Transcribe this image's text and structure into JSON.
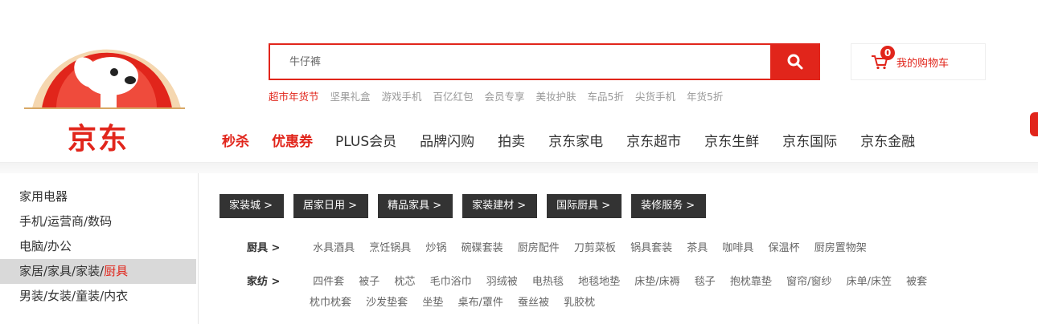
{
  "logo": {
    "text": "京东"
  },
  "search": {
    "placeholder": "牛仔裤"
  },
  "hotwords": [
    "超市年货节",
    "坚果礼盒",
    "游戏手机",
    "百亿红包",
    "会员专享",
    "美妆护肤",
    "车品5折",
    "尖货手机",
    "年货5折"
  ],
  "cart": {
    "count": "0",
    "label": "我的购物车"
  },
  "nav": [
    "秒杀",
    "优惠券",
    "PLUS会员",
    "品牌闪购",
    "拍卖",
    "京东家电",
    "京东超市",
    "京东生鲜",
    "京东国际",
    "京东金融"
  ],
  "categories": [
    {
      "label": "家用电器"
    },
    {
      "label": "手机/运营商/数码"
    },
    {
      "label": "电脑/办公"
    },
    {
      "label": "家居/家具/家装/",
      "highlight": "厨具"
    },
    {
      "label": "男装/女装/童装/内衣"
    }
  ],
  "panel": {
    "tags": [
      "家装城 >",
      "居家日用 >",
      "精品家具 >",
      "家装建材 >",
      "国际厨具 >",
      "装修服务 >"
    ],
    "rows": [
      {
        "head": "厨具 >",
        "items": [
          "水具酒具",
          "烹饪锅具",
          "炒锅",
          "碗碟套装",
          "厨房配件",
          "刀剪菜板",
          "锅具套装",
          "茶具",
          "咖啡具",
          "保温杯",
          "厨房置物架"
        ]
      },
      {
        "head": "家纺 >",
        "items": [
          "四件套",
          "被子",
          "枕芯",
          "毛巾浴巾",
          "羽绒被",
          "电热毯",
          "地毯地垫",
          "床垫/床褥",
          "毯子",
          "抱枕靠垫",
          "窗帘/窗纱",
          "床单/床笠",
          "被套"
        ],
        "items2": [
          "枕巾枕套",
          "沙发垫套",
          "坐垫",
          "桌布/罩件",
          "蚕丝被",
          "乳胶枕"
        ]
      }
    ]
  },
  "colors": {
    "brand": "#e1251b",
    "tag_bg": "#333333"
  }
}
